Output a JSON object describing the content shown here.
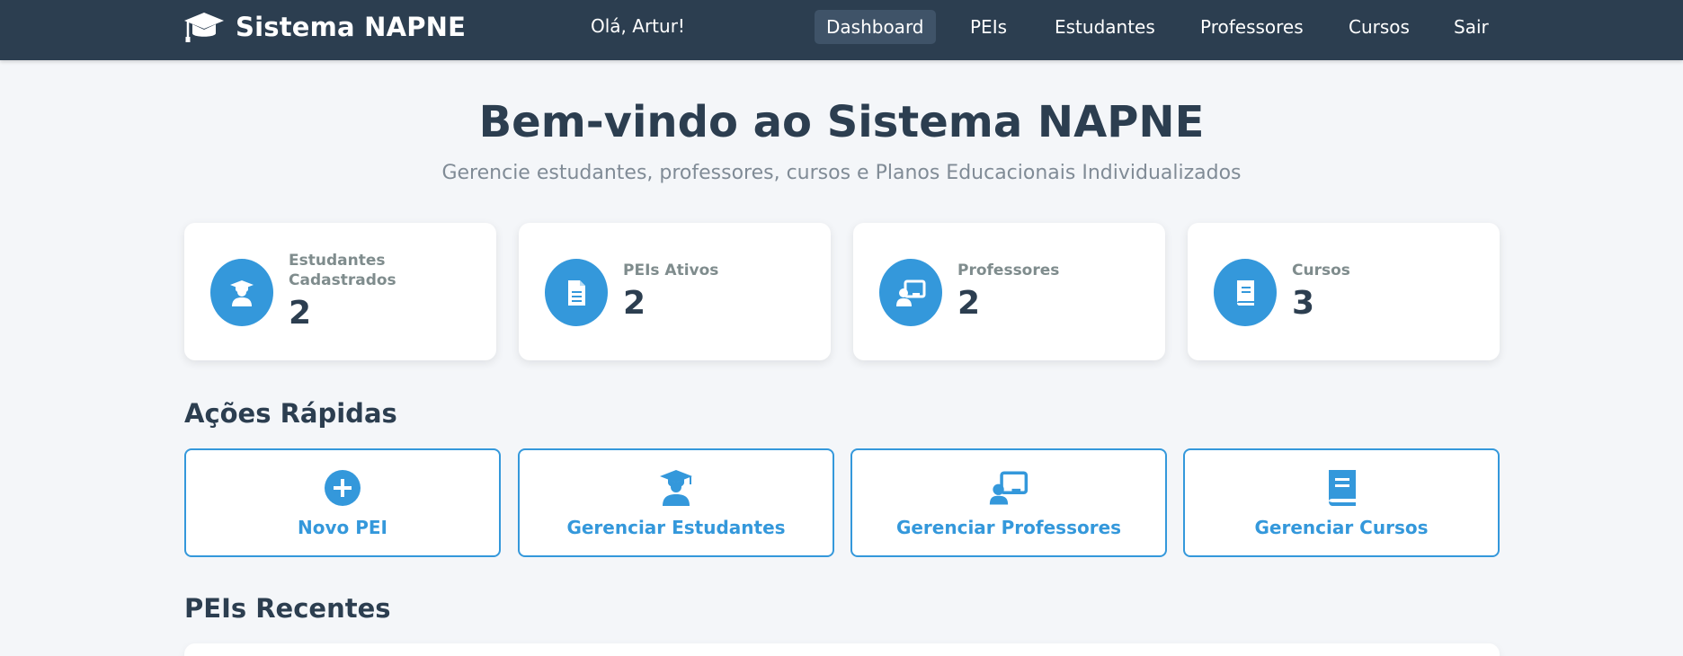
{
  "navbar": {
    "brand": "Sistema NAPNE",
    "brand_icon": "graduation-cap-icon",
    "greeting": "Olá, Artur!",
    "links": [
      "Dashboard",
      "PEIs",
      "Estudantes",
      "Professores",
      "Cursos",
      "Sair"
    ],
    "active": "Dashboard",
    "background": "#2c3e50"
  },
  "hero": {
    "title": "Bem-vindo ao Sistema NAPNE",
    "subtitle": "Gerencie estudantes, professores, cursos e Planos Educacionais Individualizados"
  },
  "stats": [
    {
      "label": "Estudantes Cadastrados",
      "value": "2",
      "icon": "student-icon"
    },
    {
      "label": "PEIs Ativos",
      "value": "2",
      "icon": "document-icon"
    },
    {
      "label": "Professores",
      "value": "2",
      "icon": "teacher-icon"
    },
    {
      "label": "Cursos",
      "value": "3",
      "icon": "book-icon"
    }
  ],
  "quick_actions": {
    "title": "Ações Rápidas",
    "items": [
      {
        "label": "Novo PEI",
        "icon": "plus-circle-icon"
      },
      {
        "label": "Gerenciar Estudantes",
        "icon": "student-icon"
      },
      {
        "label": "Gerenciar Professores",
        "icon": "teacher-icon"
      },
      {
        "label": "Gerenciar Cursos",
        "icon": "book-icon"
      }
    ]
  },
  "recent": {
    "title": "PEIs Recentes"
  },
  "colors": {
    "accent": "#3498db",
    "text": "#2c3e50",
    "muted": "#7f8c8d"
  }
}
